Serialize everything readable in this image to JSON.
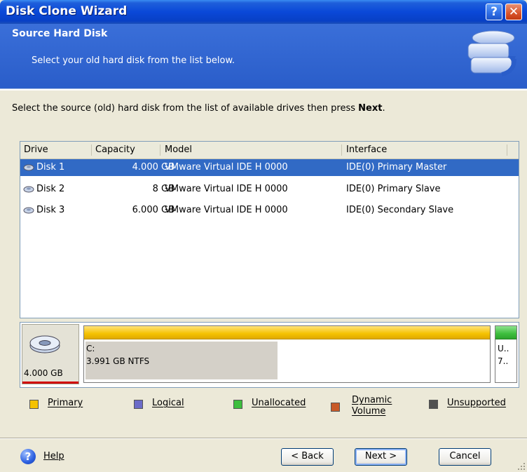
{
  "window": {
    "title": "Disk Clone Wizard",
    "help_btn": "?",
    "close_btn": "✕"
  },
  "header": {
    "title": "Source Hard Disk",
    "subtitle": "Select your old hard disk from the list below."
  },
  "instruction": {
    "text": "Select the source (old) hard disk from the list of available drives then press ",
    "bold": "Next",
    "end": "."
  },
  "table": {
    "columns": [
      "Drive",
      "Capacity",
      "Model",
      "Interface"
    ],
    "rows": [
      {
        "drive": "Disk 1",
        "capacity": "4.000 GB",
        "model": "VMware Virtual IDE H 0000",
        "interface": "IDE(0) Primary Master"
      },
      {
        "drive": "Disk 2",
        "capacity": "8 GB",
        "model": "VMware Virtual IDE H 0000",
        "interface": "IDE(0) Primary Slave"
      },
      {
        "drive": "Disk 3",
        "capacity": "6.000 GB",
        "model": "VMware Virtual IDE H 0000",
        "interface": "IDE(0) Secondary Slave"
      }
    ],
    "selected_row": 0
  },
  "disk_map": {
    "disk_size": "4.000 GB",
    "partition": {
      "letter": "C:",
      "info": "3.991 GB  NTFS"
    },
    "unalloc": {
      "line1": "U..",
      "line2": "7.."
    }
  },
  "legend": {
    "primary": "Primary",
    "logical": "Logical",
    "unallocated": "Unallocated",
    "dynamic_line1": "Dynamic",
    "dynamic_line2": "Volume",
    "unsupported": "Unsupported"
  },
  "colors": {
    "primary": "#F5C200",
    "logical": "#6B6BC8",
    "unallocated": "#3DBE3D",
    "dynamic": "#C85A28",
    "unsupported": "#505050",
    "selection": "#316AC5"
  },
  "footer": {
    "help": "Help",
    "back": "< Back",
    "next": "Next >",
    "cancel": "Cancel"
  }
}
